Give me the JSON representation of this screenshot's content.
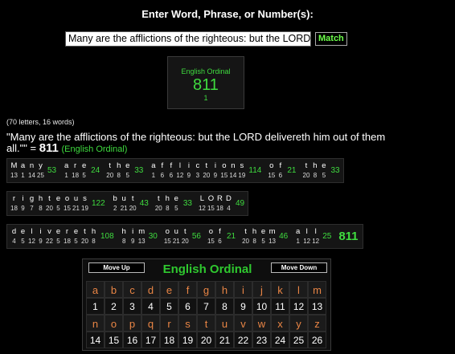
{
  "header": {
    "title": "Enter Word, Phrase, or Number(s):"
  },
  "input": {
    "value": "Many are the afflictions of the righteous: but the LORD",
    "match_label": "Match"
  },
  "cipher_box": {
    "name": "English Ordinal",
    "value": "811",
    "count": "1"
  },
  "stats": "(70 letters, 16 words)",
  "result": {
    "phrase": "\"Many are the afflictions of the righteous: but the LORD delivereth him out of them all.\"\" =",
    "value": "811",
    "cipher": "(English Ordinal)"
  },
  "rows": [
    {
      "words": [
        {
          "letters": [
            "M",
            "a",
            "n",
            "y"
          ],
          "values": [
            "13",
            "1",
            "14",
            "25"
          ],
          "sum": "53"
        },
        {
          "letters": [
            "a",
            "r",
            "e"
          ],
          "values": [
            "1",
            "18",
            "5"
          ],
          "sum": "24"
        },
        {
          "letters": [
            "t",
            "h",
            "e"
          ],
          "values": [
            "20",
            "8",
            "5"
          ],
          "sum": "33"
        },
        {
          "letters": [
            "a",
            "f",
            "f",
            "l",
            "i",
            "c",
            "t",
            "i",
            "o",
            "n",
            "s"
          ],
          "values": [
            "1",
            "6",
            "6",
            "12",
            "9",
            "3",
            "20",
            "9",
            "15",
            "14",
            "19"
          ],
          "sum": "114"
        },
        {
          "letters": [
            "o",
            "f"
          ],
          "values": [
            "15",
            "6"
          ],
          "sum": "21"
        },
        {
          "letters": [
            "t",
            "h",
            "e"
          ],
          "values": [
            "20",
            "8",
            "5"
          ],
          "sum": "33"
        }
      ],
      "total": ""
    },
    {
      "words": [
        {
          "letters": [
            "r",
            "i",
            "g",
            "h",
            "t",
            "e",
            "o",
            "u",
            "s"
          ],
          "values": [
            "18",
            "9",
            "7",
            "8",
            "20",
            "5",
            "15",
            "21",
            "19"
          ],
          "sum": "122"
        },
        {
          "letters": [
            "b",
            "u",
            "t"
          ],
          "values": [
            "2",
            "21",
            "20"
          ],
          "sum": "43"
        },
        {
          "letters": [
            "t",
            "h",
            "e"
          ],
          "values": [
            "20",
            "8",
            "5"
          ],
          "sum": "33"
        },
        {
          "letters": [
            "L",
            "O",
            "R",
            "D"
          ],
          "values": [
            "12",
            "15",
            "18",
            "4"
          ],
          "sum": "49"
        }
      ],
      "total": ""
    },
    {
      "words": [
        {
          "letters": [
            "d",
            "e",
            "l",
            "i",
            "v",
            "e",
            "r",
            "e",
            "t",
            "h"
          ],
          "values": [
            "4",
            "5",
            "12",
            "9",
            "22",
            "5",
            "18",
            "5",
            "20",
            "8"
          ],
          "sum": "108"
        },
        {
          "letters": [
            "h",
            "i",
            "m"
          ],
          "values": [
            "8",
            "9",
            "13"
          ],
          "sum": "30"
        },
        {
          "letters": [
            "o",
            "u",
            "t"
          ],
          "values": [
            "15",
            "21",
            "20"
          ],
          "sum": "56"
        },
        {
          "letters": [
            "o",
            "f"
          ],
          "values": [
            "15",
            "6"
          ],
          "sum": "21"
        },
        {
          "letters": [
            "t",
            "h",
            "e",
            "m"
          ],
          "values": [
            "20",
            "8",
            "5",
            "13"
          ],
          "sum": "46"
        },
        {
          "letters": [
            "a",
            "l",
            "l"
          ],
          "values": [
            "1",
            "12",
            "12"
          ],
          "sum": "25"
        }
      ],
      "total": "811"
    }
  ],
  "table": {
    "move_up": "Move Up",
    "move_down": "Move Down",
    "title": "English Ordinal",
    "letters1": [
      "a",
      "b",
      "c",
      "d",
      "e",
      "f",
      "g",
      "h",
      "i",
      "j",
      "k",
      "l",
      "m"
    ],
    "numbers1": [
      "1",
      "2",
      "3",
      "4",
      "5",
      "6",
      "7",
      "8",
      "9",
      "10",
      "11",
      "12",
      "13"
    ],
    "letters2": [
      "n",
      "o",
      "p",
      "q",
      "r",
      "s",
      "t",
      "u",
      "v",
      "w",
      "x",
      "y",
      "z"
    ],
    "numbers2": [
      "14",
      "15",
      "16",
      "17",
      "18",
      "19",
      "20",
      "21",
      "22",
      "23",
      "24",
      "25",
      "26"
    ]
  }
}
